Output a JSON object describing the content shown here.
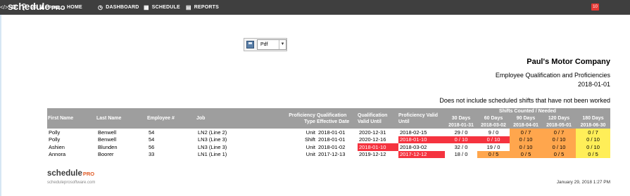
{
  "brand": {
    "name": "schedule",
    "suffix": "PRO"
  },
  "nav": {
    "items": [
      {
        "label": "HOME",
        "icon": "home-icon"
      },
      {
        "label": "DASHBOARD",
        "icon": "dashboard-icon"
      },
      {
        "label": "SCHEDULE",
        "icon": "calendar-icon"
      },
      {
        "label": "REPORTS",
        "icon": "bar-chart-icon"
      }
    ],
    "notification_count": "10",
    "user_label": "PAUL"
  },
  "export": {
    "format": "Pdf"
  },
  "report": {
    "company": "Paul's Motor Company",
    "title": "Employee Qualification and Proficiencies",
    "date": "2018-01-01",
    "note": "Does not include scheduled shifts that have not been worked"
  },
  "table": {
    "headers": {
      "first_name": "First Name",
      "last_name": "Last Name",
      "employee_no": "Employee #",
      "job": "Job",
      "prof_type_1": "Proficiency",
      "prof_type_2": "Type",
      "qual_eff_1": "Qualification",
      "qual_eff_2": "Effective Date",
      "qual_valid_1": "Qualification",
      "qual_valid_2": "Valid Until",
      "prof_valid_1": "Proficiency Valid",
      "prof_valid_2": "Until",
      "group": "Shifts Counted / Needed",
      "periods": [
        {
          "label": "30 Days",
          "date": "2018-01-31"
        },
        {
          "label": "60 Days",
          "date": "2018-03-02"
        },
        {
          "label": "90 Days",
          "date": "2018-04-01"
        },
        {
          "label": "120 Days",
          "date": "2018-05-01"
        },
        {
          "label": "180 Days",
          "date": "2018-06-30"
        }
      ]
    },
    "rows": [
      {
        "first": "Polly",
        "last": "Benwell",
        "emp": "54",
        "job": "LN2 (Line 2)",
        "ptype": "Unit",
        "eff": "2018-01-01",
        "valid": "2020-12-31",
        "pvalid": "2018-02-15",
        "shifts": [
          "29 / 0",
          "9 / 0",
          "0 / 7",
          "0 / 7",
          "0 / 7"
        ]
      },
      {
        "first": "Polly",
        "last": "Benwell",
        "emp": "54",
        "job": "LN3 (Line 3)",
        "ptype": "Shift",
        "eff": "2018-01-01",
        "valid": "2020-12-16",
        "pvalid": "2018-01-10",
        "shifts": [
          "0 / 10",
          "0 / 10",
          "0 / 10",
          "0 / 10",
          "0 / 10"
        ]
      },
      {
        "first": "Ashien",
        "last": "Blunden",
        "emp": "56",
        "job": "LN3 (Line 3)",
        "ptype": "Unit",
        "eff": "2018-01-02",
        "valid": "2018-01-10",
        "pvalid": "2018-03-02",
        "shifts": [
          "32 / 0",
          "19 / 0",
          "0 / 10",
          "0 / 10",
          "0 / 10"
        ]
      },
      {
        "first": "Annora",
        "last": "Boorer",
        "emp": "33",
        "job": "LN1 (Line 1)",
        "ptype": "Unit",
        "eff": "2017-12-13",
        "valid": "2019-12-12",
        "pvalid": "2017-12-12",
        "shifts": [
          "18 / 0",
          "0 / 5",
          "0 / 5",
          "0 / 5",
          "0 / 5"
        ]
      }
    ]
  },
  "footer": {
    "logo_name": "schedule",
    "logo_suffix": "PRO",
    "site": "scheduleprosoftware.com",
    "timestamp": "January 29, 2018 1:27 PM"
  },
  "colors": {
    "topbar": "#3f3f3f",
    "header": "#9e9e9e",
    "red": "#f5333f",
    "orange": "#ffa64d",
    "yellow": "#ffee58"
  }
}
